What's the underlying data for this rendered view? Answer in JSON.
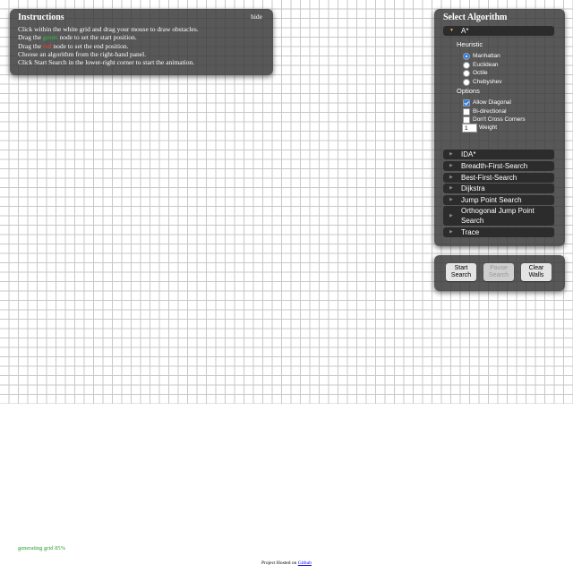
{
  "instructions": {
    "title": "Instructions",
    "hide_label": "hide",
    "line1": "Click within the white grid and drag your mouse to draw obstacles.",
    "line2_pre": "Drag the ",
    "line2_color": "green",
    "line2_post": " node to set the start position.",
    "line3_pre": "Drag the ",
    "line3_color": "red",
    "line3_post": " node to set the end position.",
    "line4": "Choose an algorithm from the right-hand panel.",
    "line5": "Click Start Search in the lower-right corner to start the animation."
  },
  "algorithm_panel": {
    "title": "Select Algorithm",
    "astar": {
      "label": "A*",
      "heuristic_label": "Heuristic",
      "heuristics": [
        {
          "label": "Manhattan",
          "checked": true
        },
        {
          "label": "Euclidean",
          "checked": false
        },
        {
          "label": "Octile",
          "checked": false
        },
        {
          "label": "Chebyshev",
          "checked": false
        }
      ],
      "options_label": "Options",
      "options": [
        {
          "label": "Allow Diagonal",
          "checked": true
        },
        {
          "label": "Bi-directional",
          "checked": false
        },
        {
          "label": "Don't Cross Corners",
          "checked": false
        }
      ],
      "weight_value": "1",
      "weight_label": "Weight"
    },
    "algorithms": [
      "IDA*",
      "Breadth-First-Search",
      "Best-First-Search",
      "Dijkstra",
      "Jump Point Search",
      "Orthogonal Jump Point Search",
      "Trace"
    ]
  },
  "controls": {
    "start_label": "Start Search",
    "pause_label": "Pause Search",
    "clear_label": "Clear Walls"
  },
  "status": {
    "text": "generating grid 85%",
    "progress_percent": 85
  },
  "footer": {
    "text": "Project Hosted on ",
    "link_label": "Github"
  },
  "colors": {
    "panel_bg": "#383838",
    "grid_line": "#c8c8c8",
    "start_node": "#2ecc40",
    "end_node": "#ff4136",
    "status_text": "#2ca02c",
    "checked_control": "#2f7fe8"
  }
}
